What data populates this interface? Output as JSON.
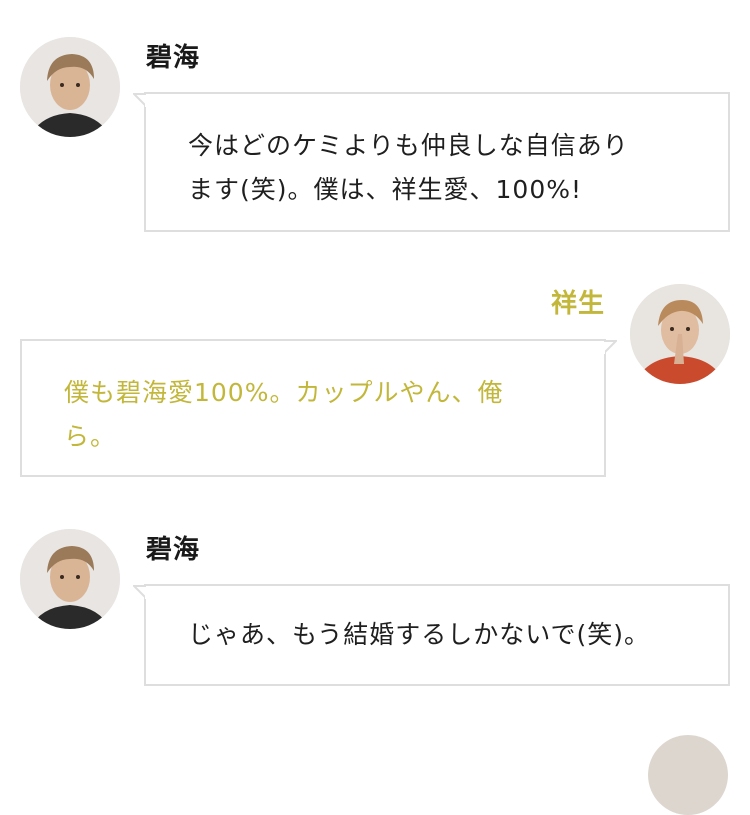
{
  "messages": [
    {
      "speaker": "碧海",
      "side": "left",
      "text": "今はどのケミよりも仲良しな自信あり\nます(笑)。僕は、祥生愛、100%!"
    },
    {
      "speaker": "祥生",
      "side": "right",
      "text": "僕も碧海愛100%。カップルやん、俺\nら。"
    },
    {
      "speaker": "碧海",
      "side": "left",
      "text": "じゃあ、もう結婚するしかないで(笑)。"
    }
  ],
  "colors": {
    "accent": "#c2b73a",
    "bubble_border": "#dedede",
    "text": "#1f1f1f"
  }
}
